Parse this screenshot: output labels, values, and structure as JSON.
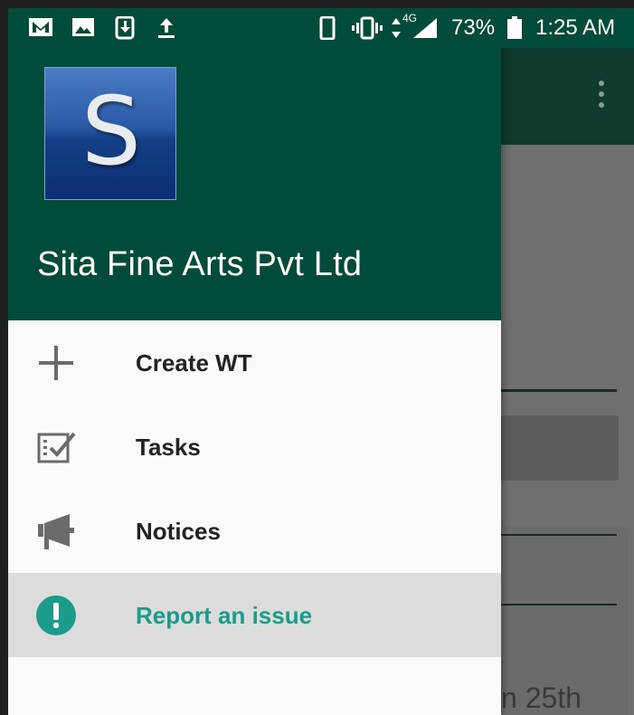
{
  "status_bar": {
    "network": "4G",
    "battery": "73%",
    "time": "1:25 AM"
  },
  "drawer": {
    "logo_letter": "S",
    "company_name": "Sita Fine Arts Pvt Ltd",
    "items": [
      {
        "label": "Create WT",
        "icon": "plus-icon",
        "selected": false
      },
      {
        "label": "Tasks",
        "icon": "tasks-checklist-icon",
        "selected": false
      },
      {
        "label": "Notices",
        "icon": "megaphone-icon",
        "selected": false
      },
      {
        "label": "Report an issue",
        "icon": "alert-icon",
        "selected": true
      }
    ]
  },
  "background_screen": {
    "partial_text": "n 25th"
  },
  "colors": {
    "primary_dark": "#004b3a",
    "accent": "#1b9b8a",
    "selected_row": "#dcdcdc"
  }
}
